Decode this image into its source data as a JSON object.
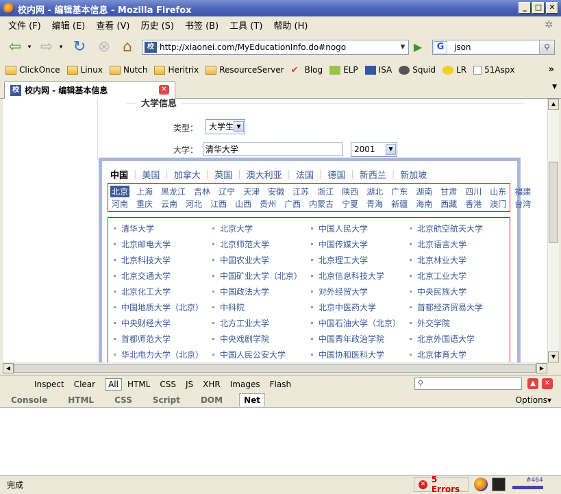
{
  "window": {
    "title": "校内网 - 编辑基本信息 - Mozilla Firefox"
  },
  "menu": [
    "文件 (F)",
    "编辑 (E)",
    "查看 (V)",
    "历史 (S)",
    "书签 (B)",
    "工具 (T)",
    "帮助 (H)"
  ],
  "nav": {
    "url": "http://xiaonei.com/MyEducationInfo.do#nogo",
    "search_value": "json",
    "site_icon": "校"
  },
  "bookmarks": [
    "ClickOnce",
    "Linux",
    "Nutch",
    "Heritrix",
    "ResourceServer",
    "Blog",
    "ELP",
    "ISA",
    "Squid",
    "LR",
    "51Aspx"
  ],
  "tab": {
    "label": "校内网 - 编辑基本信息"
  },
  "section": {
    "title": "大学信息",
    "type_label": "类型：",
    "type_value": "大学生",
    "university_label": "大学：",
    "university_value": "清华大学",
    "year_value": "2001"
  },
  "countries": [
    "中国",
    "美国",
    "加拿大",
    "英国",
    "澳大利亚",
    "法国",
    "德国",
    "新西兰",
    "新加坡"
  ],
  "provinces": {
    "row1": [
      "北京",
      "上海",
      "黑龙江",
      "吉林",
      "辽宁",
      "天津",
      "安徽",
      "江苏",
      "浙江",
      "陕西",
      "湖北",
      "广东",
      "湖南",
      "甘肃",
      "四川",
      "山东",
      "福建"
    ],
    "row2": [
      "河南",
      "重庆",
      "云南",
      "河北",
      "江西",
      "山西",
      "贵州",
      "广西",
      "内蒙古",
      "宁夏",
      "青海",
      "新疆",
      "海南",
      "西藏",
      "香港",
      "澳门",
      "台湾"
    ]
  },
  "universities": [
    "清华大学",
    "北京大学",
    "中国人民大学",
    "北京航空航天大学",
    "北京邮电大学",
    "北京师范大学",
    "中国传媒大学",
    "北京语言大学",
    "北京科技大学",
    "中国农业大学",
    "北京理工大学",
    "北京林业大学",
    "北京交通大学",
    "中国矿业大学（北京）",
    "北京信息科技大学",
    "北京工业大学",
    "北京化工大学",
    "中国政法大学",
    "对外经贸大学",
    "中央民族大学",
    "中国地质大学（北京）",
    "中科院",
    "北京中医药大学",
    "首都经济贸易大学",
    "中央财经大学",
    "北方工业大学",
    "中国石油大学（北京）",
    "外交学院",
    "首都师范大学",
    "中央戏剧学院",
    "中国青年政治学院",
    "北京外国语大学",
    "华北电力大学（北京）",
    "中国人民公安大学",
    "中国协和医科大学",
    "北京体育大学"
  ],
  "firebug": {
    "toolbar": [
      "Inspect",
      "Clear",
      "All",
      "HTML",
      "CSS",
      "JS",
      "XHR",
      "Images",
      "Flash"
    ],
    "tabs": [
      "Console",
      "HTML",
      "CSS",
      "Script",
      "DOM",
      "Net"
    ],
    "options": "Options▾"
  },
  "status": {
    "text": "完成",
    "errors": "5 Errors",
    "alexa_rank": "#464"
  }
}
